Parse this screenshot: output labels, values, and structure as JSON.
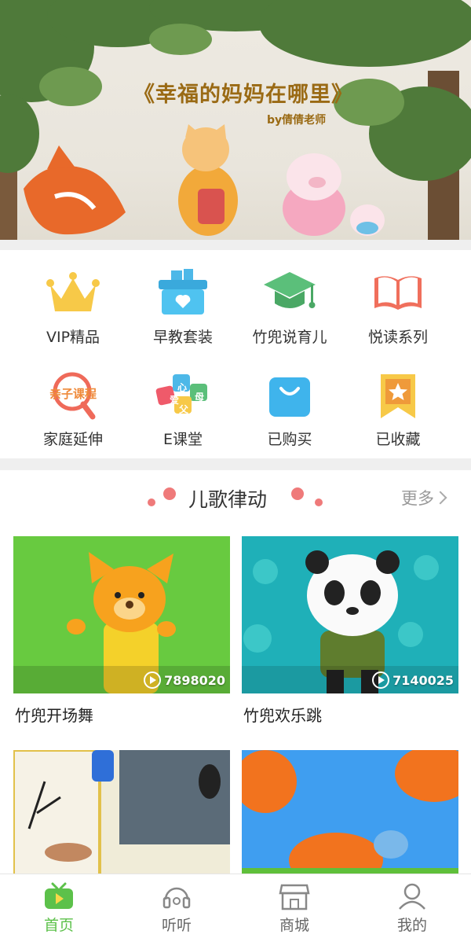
{
  "banner": {
    "title": "《幸福的妈妈在哪里》",
    "subtitle": "by倩倩老师"
  },
  "menu": [
    {
      "label": "VIP精品",
      "icon": "crown-icon"
    },
    {
      "label": "早教套装",
      "icon": "gift-basket-icon"
    },
    {
      "label": "竹兜说育儿",
      "icon": "graduation-cap-icon"
    },
    {
      "label": "悦读系列",
      "icon": "open-book-icon"
    },
    {
      "label": "家庭延伸",
      "icon": "magnifier-icon",
      "icon_text": "亲子课程"
    },
    {
      "label": "E课堂",
      "icon": "letter-cards-icon",
      "icon_text": [
        "爱",
        "心",
        "父",
        "母"
      ]
    },
    {
      "label": "已购买",
      "icon": "shopping-bag-icon"
    },
    {
      "label": "已收藏",
      "icon": "bookmark-star-icon"
    }
  ],
  "section": {
    "title": "儿歌律动",
    "more": "更多"
  },
  "cards": [
    {
      "title": "竹兜开场舞",
      "plays": "7898020"
    },
    {
      "title": "竹兜欢乐跳",
      "plays": "7140025"
    },
    {
      "title": "",
      "plays": ""
    },
    {
      "title": "",
      "plays": ""
    }
  ],
  "tabs": [
    {
      "label": "首页",
      "icon": "tv-icon",
      "active": true
    },
    {
      "label": "听听",
      "icon": "headphone-music-icon",
      "active": false
    },
    {
      "label": "商城",
      "icon": "store-icon",
      "active": false
    },
    {
      "label": "我的",
      "icon": "user-icon",
      "active": false
    }
  ],
  "colors": {
    "accent": "#5cc14a",
    "section_dot": "#ef7a7a",
    "banner_title": "#9a6a14"
  }
}
